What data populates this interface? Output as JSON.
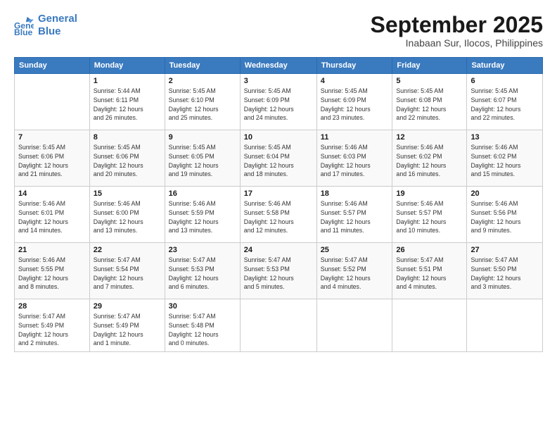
{
  "header": {
    "logo_line1": "General",
    "logo_line2": "Blue",
    "month": "September 2025",
    "location": "Inabaan Sur, Ilocos, Philippines"
  },
  "days_of_week": [
    "Sunday",
    "Monday",
    "Tuesday",
    "Wednesday",
    "Thursday",
    "Friday",
    "Saturday"
  ],
  "weeks": [
    [
      {
        "day": "",
        "info": ""
      },
      {
        "day": "1",
        "info": "Sunrise: 5:44 AM\nSunset: 6:11 PM\nDaylight: 12 hours\nand 26 minutes."
      },
      {
        "day": "2",
        "info": "Sunrise: 5:45 AM\nSunset: 6:10 PM\nDaylight: 12 hours\nand 25 minutes."
      },
      {
        "day": "3",
        "info": "Sunrise: 5:45 AM\nSunset: 6:09 PM\nDaylight: 12 hours\nand 24 minutes."
      },
      {
        "day": "4",
        "info": "Sunrise: 5:45 AM\nSunset: 6:09 PM\nDaylight: 12 hours\nand 23 minutes."
      },
      {
        "day": "5",
        "info": "Sunrise: 5:45 AM\nSunset: 6:08 PM\nDaylight: 12 hours\nand 22 minutes."
      },
      {
        "day": "6",
        "info": "Sunrise: 5:45 AM\nSunset: 6:07 PM\nDaylight: 12 hours\nand 22 minutes."
      }
    ],
    [
      {
        "day": "7",
        "info": "Sunrise: 5:45 AM\nSunset: 6:06 PM\nDaylight: 12 hours\nand 21 minutes."
      },
      {
        "day": "8",
        "info": "Sunrise: 5:45 AM\nSunset: 6:06 PM\nDaylight: 12 hours\nand 20 minutes."
      },
      {
        "day": "9",
        "info": "Sunrise: 5:45 AM\nSunset: 6:05 PM\nDaylight: 12 hours\nand 19 minutes."
      },
      {
        "day": "10",
        "info": "Sunrise: 5:45 AM\nSunset: 6:04 PM\nDaylight: 12 hours\nand 18 minutes."
      },
      {
        "day": "11",
        "info": "Sunrise: 5:46 AM\nSunset: 6:03 PM\nDaylight: 12 hours\nand 17 minutes."
      },
      {
        "day": "12",
        "info": "Sunrise: 5:46 AM\nSunset: 6:02 PM\nDaylight: 12 hours\nand 16 minutes."
      },
      {
        "day": "13",
        "info": "Sunrise: 5:46 AM\nSunset: 6:02 PM\nDaylight: 12 hours\nand 15 minutes."
      }
    ],
    [
      {
        "day": "14",
        "info": "Sunrise: 5:46 AM\nSunset: 6:01 PM\nDaylight: 12 hours\nand 14 minutes."
      },
      {
        "day": "15",
        "info": "Sunrise: 5:46 AM\nSunset: 6:00 PM\nDaylight: 12 hours\nand 13 minutes."
      },
      {
        "day": "16",
        "info": "Sunrise: 5:46 AM\nSunset: 5:59 PM\nDaylight: 12 hours\nand 13 minutes."
      },
      {
        "day": "17",
        "info": "Sunrise: 5:46 AM\nSunset: 5:58 PM\nDaylight: 12 hours\nand 12 minutes."
      },
      {
        "day": "18",
        "info": "Sunrise: 5:46 AM\nSunset: 5:57 PM\nDaylight: 12 hours\nand 11 minutes."
      },
      {
        "day": "19",
        "info": "Sunrise: 5:46 AM\nSunset: 5:57 PM\nDaylight: 12 hours\nand 10 minutes."
      },
      {
        "day": "20",
        "info": "Sunrise: 5:46 AM\nSunset: 5:56 PM\nDaylight: 12 hours\nand 9 minutes."
      }
    ],
    [
      {
        "day": "21",
        "info": "Sunrise: 5:46 AM\nSunset: 5:55 PM\nDaylight: 12 hours\nand 8 minutes."
      },
      {
        "day": "22",
        "info": "Sunrise: 5:47 AM\nSunset: 5:54 PM\nDaylight: 12 hours\nand 7 minutes."
      },
      {
        "day": "23",
        "info": "Sunrise: 5:47 AM\nSunset: 5:53 PM\nDaylight: 12 hours\nand 6 minutes."
      },
      {
        "day": "24",
        "info": "Sunrise: 5:47 AM\nSunset: 5:53 PM\nDaylight: 12 hours\nand 5 minutes."
      },
      {
        "day": "25",
        "info": "Sunrise: 5:47 AM\nSunset: 5:52 PM\nDaylight: 12 hours\nand 4 minutes."
      },
      {
        "day": "26",
        "info": "Sunrise: 5:47 AM\nSunset: 5:51 PM\nDaylight: 12 hours\nand 4 minutes."
      },
      {
        "day": "27",
        "info": "Sunrise: 5:47 AM\nSunset: 5:50 PM\nDaylight: 12 hours\nand 3 minutes."
      }
    ],
    [
      {
        "day": "28",
        "info": "Sunrise: 5:47 AM\nSunset: 5:49 PM\nDaylight: 12 hours\nand 2 minutes."
      },
      {
        "day": "29",
        "info": "Sunrise: 5:47 AM\nSunset: 5:49 PM\nDaylight: 12 hours\nand 1 minute."
      },
      {
        "day": "30",
        "info": "Sunrise: 5:47 AM\nSunset: 5:48 PM\nDaylight: 12 hours\nand 0 minutes."
      },
      {
        "day": "",
        "info": ""
      },
      {
        "day": "",
        "info": ""
      },
      {
        "day": "",
        "info": ""
      },
      {
        "day": "",
        "info": ""
      }
    ]
  ]
}
